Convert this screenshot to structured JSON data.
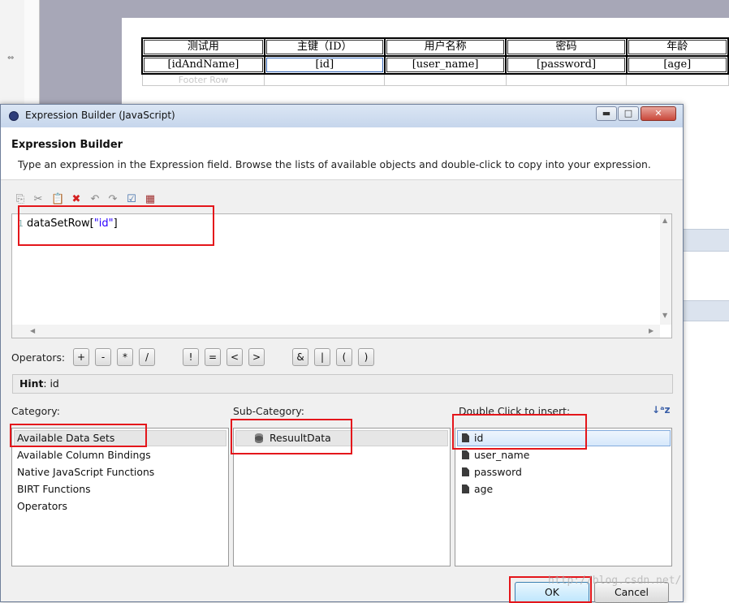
{
  "report": {
    "headers": [
      "测试用",
      "主键（ID）",
      "用户名称",
      "密码",
      "年龄"
    ],
    "fields": [
      "[idAndName]",
      "[id]",
      "[user_name]",
      "[password]",
      "[age]"
    ],
    "footer_label": "Footer Row"
  },
  "dialog": {
    "title": "Expression Builder (JavaScript)",
    "window_buttons": {
      "minimize": "▬",
      "maximize": "□",
      "close": "✕"
    },
    "heading": "Expression Builder",
    "description": "Type an expression in the Expression field. Browse the lists of available objects and double-click to copy into your expression.",
    "toolbar_icons": [
      "copy-icon",
      "cut-icon",
      "paste-icon",
      "delete-icon",
      "undo-icon",
      "redo-icon",
      "validate-icon",
      "calendar-icon"
    ],
    "editor": {
      "line_number": "1",
      "code_prefix": "dataSetRow[",
      "code_string": "\"id\"",
      "code_suffix": "]"
    },
    "operators_label": "Operators:",
    "operators": [
      "+",
      "-",
      "*",
      "/",
      "!",
      "=",
      "<",
      ">",
      "&",
      "|",
      "(",
      ")"
    ],
    "hint_label": "Hint",
    "hint_value": ": id",
    "category": {
      "label": "Category:",
      "items": [
        "Available Data Sets",
        "Available Column Bindings",
        "Native JavaScript Functions",
        "BIRT Functions",
        "Operators"
      ],
      "selected": "Available Data Sets"
    },
    "subcategory": {
      "label": "Sub-Category:",
      "items": [
        "ResuultData"
      ]
    },
    "insert": {
      "label": "Double Click to insert:",
      "items": [
        "id",
        "user_name",
        "password",
        "age"
      ],
      "selected": "id"
    },
    "ok_label": "OK",
    "cancel_label": "Cancel"
  },
  "watermark": "http://blog.csdn.net/",
  "colors": {
    "highlight_box": "#e4161b",
    "string_literal": "#2a00ff"
  }
}
